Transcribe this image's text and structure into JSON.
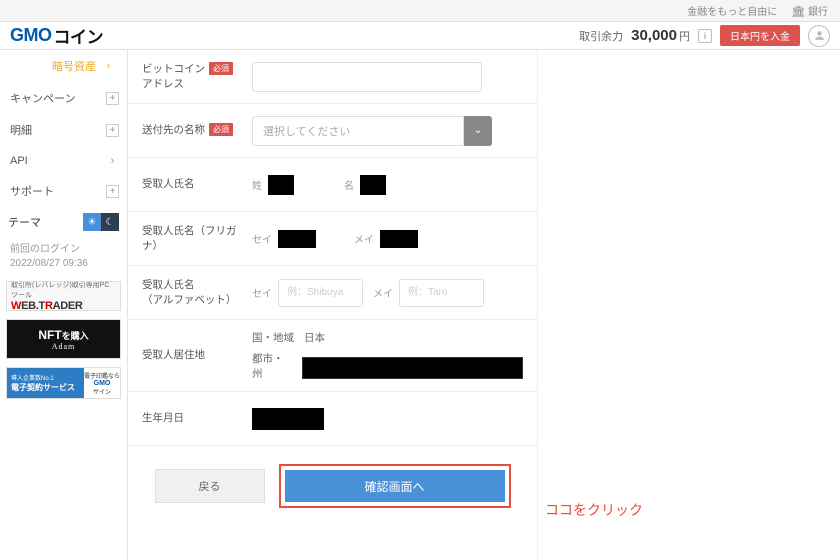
{
  "topbar": {
    "tagline": "金融をもっと自由に",
    "bank": "銀行"
  },
  "header": {
    "logo_gmo": "GMO",
    "logo_coin": "コイン",
    "balance_label": "取引余力",
    "balance_amount": "30,000",
    "balance_unit": "円",
    "deposit": "日本円を入金"
  },
  "sidebar": {
    "items": [
      {
        "label": "暗号資産",
        "type": "active"
      },
      {
        "label": "キャンペーン",
        "type": "plus"
      },
      {
        "label": "明細",
        "type": "plus"
      },
      {
        "label": "API",
        "type": "arrow"
      },
      {
        "label": "サポート",
        "type": "plus"
      }
    ],
    "theme_label": "テーマ",
    "login_label": "前回のログイン",
    "login_time": "2022/08/27 09:36",
    "promo_webtrader_top": "取引所(レバレッジ)取引専用PCツール",
    "promo_webtrader_main": "WEB.TRADER",
    "promo_nft_main": "NFT",
    "promo_nft_buy": "を購入",
    "promo_nft_adam": "Adam",
    "promo_sign_l1": "導入企業数No.1",
    "promo_sign_l2": "電子契約サービス",
    "promo_sign_r1": "電子印鑑なら",
    "promo_sign_r2": "GMO",
    "promo_sign_r3": "サイン"
  },
  "form": {
    "btc_address_l1": "ビットコイン",
    "btc_address_l2": "アドレス",
    "required": "必須",
    "dest_name": "送付先の名称",
    "select_placeholder": "選択してください",
    "recipient_name": "受取人氏名",
    "sei": "姓",
    "mei": "名",
    "recipient_furigana": "受取人氏名（フリガナ）",
    "sei_kana": "セイ",
    "mei_kana": "メイ",
    "recipient_alpha_l1": "受取人氏名",
    "recipient_alpha_l2": "（アルファベット）",
    "alpha_sei": "セイ",
    "alpha_mei": "メイ",
    "ph_sei": "例：Shibuya",
    "ph_mei": "例：Taro",
    "residence": "受取人居住地",
    "country_label": "国・地域",
    "country_value": "日本",
    "city_label": "都市・州",
    "dob": "生年月日",
    "back": "戻る",
    "confirm": "確認画面へ"
  },
  "annotation": "ココをクリック"
}
